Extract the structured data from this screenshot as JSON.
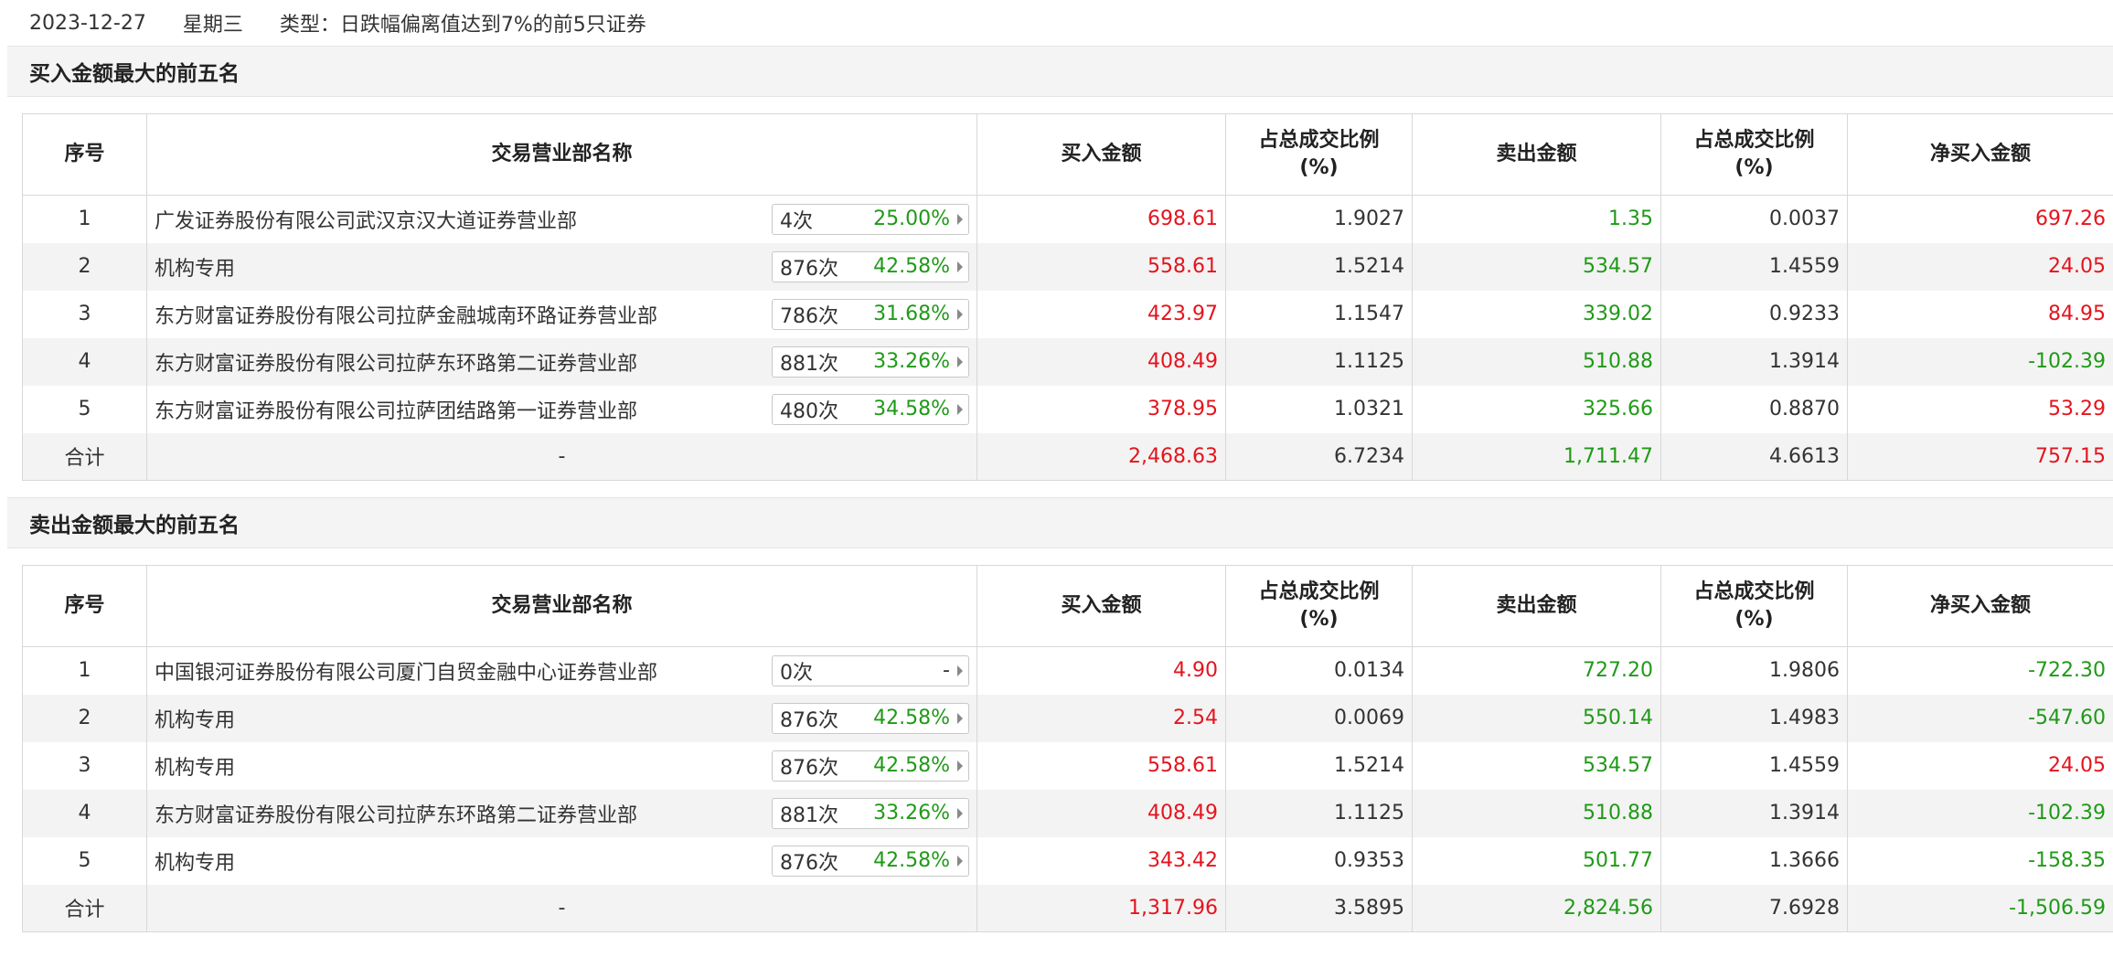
{
  "header": {
    "date": "2023-12-27",
    "weekday": "星期三",
    "type": "类型：日跌幅偏离值达到7%的前5只证券"
  },
  "columns": [
    "序号",
    "交易营业部名称",
    "买入金额",
    "占总成交比例\n(%)",
    "卖出金额",
    "占总成交比例\n(%)",
    "净买入金额"
  ],
  "colors": {
    "up": "#e4141d",
    "down": "#1f9a17",
    "row_alt": "#f3f3f3",
    "section_bg": "#f4f4f4"
  },
  "sections": [
    {
      "title": "买入金额最大的前五名",
      "rows": [
        {
          "idx": "1",
          "name": "广发证券股份有限公司武汉京汉大道证券营业部",
          "count": "4次",
          "pct": "25.00%",
          "buy": "698.61",
          "buy_ratio": "1.9027",
          "sell": "1.35",
          "sell_ratio": "0.0037",
          "net": "697.26"
        },
        {
          "idx": "2",
          "name": "机构专用",
          "count": "876次",
          "pct": "42.58%",
          "buy": "558.61",
          "buy_ratio": "1.5214",
          "sell": "534.57",
          "sell_ratio": "1.4559",
          "net": "24.05"
        },
        {
          "idx": "3",
          "name": "东方财富证券股份有限公司拉萨金融城南环路证券营业部",
          "count": "786次",
          "pct": "31.68%",
          "buy": "423.97",
          "buy_ratio": "1.1547",
          "sell": "339.02",
          "sell_ratio": "0.9233",
          "net": "84.95"
        },
        {
          "idx": "4",
          "name": "东方财富证券股份有限公司拉萨东环路第二证券营业部",
          "count": "881次",
          "pct": "33.26%",
          "buy": "408.49",
          "buy_ratio": "1.1125",
          "sell": "510.88",
          "sell_ratio": "1.3914",
          "net": "-102.39"
        },
        {
          "idx": "5",
          "name": "东方财富证券股份有限公司拉萨团结路第一证券营业部",
          "count": "480次",
          "pct": "34.58%",
          "buy": "378.95",
          "buy_ratio": "1.0321",
          "sell": "325.66",
          "sell_ratio": "0.8870",
          "net": "53.29"
        }
      ],
      "total": {
        "label": "合计",
        "name": "-",
        "buy": "2,468.63",
        "buy_ratio": "6.7234",
        "sell": "1,711.47",
        "sell_ratio": "4.6613",
        "net": "757.15"
      }
    },
    {
      "title": "卖出金额最大的前五名",
      "rows": [
        {
          "idx": "1",
          "name": "中国银河证券股份有限公司厦门自贸金融中心证券营业部",
          "count": "0次",
          "pct": "-",
          "buy": "4.90",
          "buy_ratio": "0.0134",
          "sell": "727.20",
          "sell_ratio": "1.9806",
          "net": "-722.30"
        },
        {
          "idx": "2",
          "name": "机构专用",
          "count": "876次",
          "pct": "42.58%",
          "buy": "2.54",
          "buy_ratio": "0.0069",
          "sell": "550.14",
          "sell_ratio": "1.4983",
          "net": "-547.60"
        },
        {
          "idx": "3",
          "name": "机构专用",
          "count": "876次",
          "pct": "42.58%",
          "buy": "558.61",
          "buy_ratio": "1.5214",
          "sell": "534.57",
          "sell_ratio": "1.4559",
          "net": "24.05"
        },
        {
          "idx": "4",
          "name": "东方财富证券股份有限公司拉萨东环路第二证券营业部",
          "count": "881次",
          "pct": "33.26%",
          "buy": "408.49",
          "buy_ratio": "1.1125",
          "sell": "510.88",
          "sell_ratio": "1.3914",
          "net": "-102.39"
        },
        {
          "idx": "5",
          "name": "机构专用",
          "count": "876次",
          "pct": "42.58%",
          "buy": "343.42",
          "buy_ratio": "0.9353",
          "sell": "501.77",
          "sell_ratio": "1.3666",
          "net": "-158.35"
        }
      ],
      "total": {
        "label": "合计",
        "name": "-",
        "buy": "1,317.96",
        "buy_ratio": "3.5895",
        "sell": "2,824.56",
        "sell_ratio": "7.6928",
        "net": "-1,506.59"
      }
    }
  ]
}
